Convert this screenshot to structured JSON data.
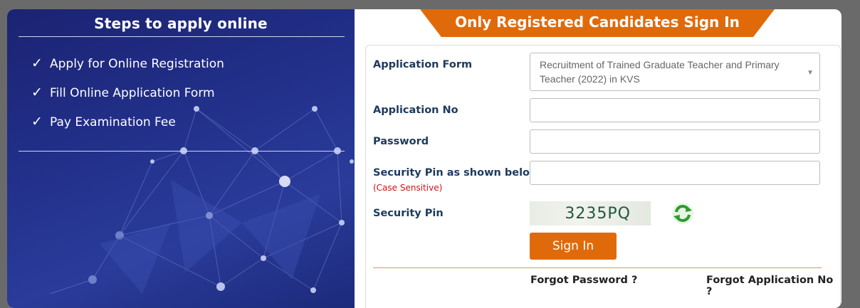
{
  "steps_panel": {
    "title": "Steps to apply online",
    "steps": [
      {
        "check": "✓",
        "label": "Apply for Online Registration"
      },
      {
        "check": "✓",
        "label": "Fill Online Application Form"
      },
      {
        "check": "✓",
        "label": "Pay Examination Fee"
      }
    ]
  },
  "signin": {
    "banner": "Only Registered Candidates Sign In",
    "application_form_label": "Application Form",
    "application_form_value": "Recruitment of Trained Graduate Teacher and Primary Teacher (2022) in KVS",
    "application_no_label": "Application No",
    "application_no_value": "",
    "password_label": "Password",
    "password_value": "",
    "security_pin_input_label": "Security Pin as shown below",
    "case_sensitive_note": "(Case Sensitive)",
    "security_pin_input_value": "",
    "security_pin_label": "Security Pin",
    "captcha_text": "3235PQ",
    "refresh_icon": "refresh-icon",
    "sign_in_button": "Sign In",
    "forgot_password": "Forgot Password ?",
    "forgot_application_no": "Forgot Application No ?"
  },
  "colors": {
    "accent_orange": "#e06a0a",
    "label_navy": "#1d3a5c",
    "panel_blue": "#22308a",
    "warning_red": "#d01414"
  }
}
